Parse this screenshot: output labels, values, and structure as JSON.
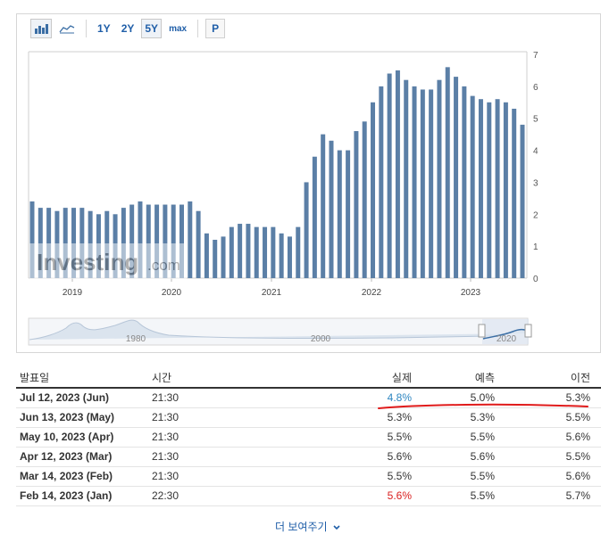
{
  "toolbar": {
    "bar_icon": "bar-chart-icon",
    "area_icon": "area-chart-icon",
    "range_1y": "1Y",
    "range_2y": "2Y",
    "range_5y": "5Y",
    "range_max": "max",
    "pin_label": "P"
  },
  "watermark": {
    "brand": "Investing",
    "suffix": ".com"
  },
  "chart_data": {
    "type": "bar",
    "y_ticks": [
      0,
      1,
      2,
      3,
      4,
      5,
      6,
      7
    ],
    "ylim": [
      0,
      7
    ],
    "x_tick_labels": [
      "2019",
      "2020",
      "2021",
      "2022",
      "2023"
    ],
    "bar_color": "#5b7fa6",
    "values": [
      2.4,
      2.2,
      2.2,
      2.1,
      2.2,
      2.2,
      2.2,
      2.1,
      2.0,
      2.1,
      2.0,
      2.2,
      2.3,
      2.4,
      2.3,
      2.3,
      2.3,
      2.3,
      2.3,
      2.4,
      2.1,
      1.4,
      1.2,
      1.3,
      1.6,
      1.7,
      1.7,
      1.6,
      1.6,
      1.6,
      1.4,
      1.3,
      1.6,
      3.0,
      3.8,
      4.5,
      4.3,
      4.0,
      4.0,
      4.6,
      4.9,
      5.5,
      6.0,
      6.4,
      6.5,
      6.2,
      6.0,
      5.9,
      5.9,
      6.2,
      6.6,
      6.3,
      6.0,
      5.7,
      5.6,
      5.5,
      5.6,
      5.5,
      5.3,
      4.8
    ],
    "navigator_labels": [
      "1980",
      "2000",
      "2020"
    ]
  },
  "table": {
    "headers": {
      "date": "발표일",
      "time": "시간",
      "actual": "실제",
      "forecast": "예측",
      "previous": "이전"
    },
    "rows": [
      {
        "date": "Jul 12, 2023 (Jun)",
        "time": "21:30",
        "actual": "4.8%",
        "forecast": "5.0%",
        "previous": "5.3%",
        "actual_color": "blue"
      },
      {
        "date": "Jun 13, 2023 (May)",
        "time": "21:30",
        "actual": "5.3%",
        "forecast": "5.3%",
        "previous": "5.5%",
        "actual_color": "default"
      },
      {
        "date": "May 10, 2023 (Apr)",
        "time": "21:30",
        "actual": "5.5%",
        "forecast": "5.5%",
        "previous": "5.6%",
        "actual_color": "default"
      },
      {
        "date": "Apr 12, 2023 (Mar)",
        "time": "21:30",
        "actual": "5.6%",
        "forecast": "5.6%",
        "previous": "5.5%",
        "actual_color": "default"
      },
      {
        "date": "Mar 14, 2023 (Feb)",
        "time": "21:30",
        "actual": "5.5%",
        "forecast": "5.5%",
        "previous": "5.6%",
        "actual_color": "default"
      },
      {
        "date": "Feb 14, 2023 (Jan)",
        "time": "22:30",
        "actual": "5.6%",
        "forecast": "5.5%",
        "previous": "5.7%",
        "actual_color": "red"
      }
    ]
  },
  "colors": {
    "blue_value": "#2e86c1",
    "red_value": "#d91e1e",
    "annotation": "#e01b1b"
  },
  "more_link": "더 보여주기"
}
